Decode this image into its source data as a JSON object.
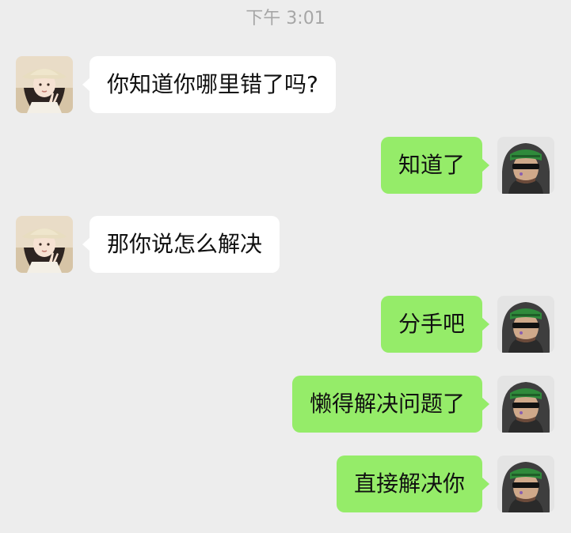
{
  "timestamp": "下午 3:01",
  "messages": [
    {
      "sender": "other",
      "text": "你知道你哪里错了吗?"
    },
    {
      "sender": "me",
      "text": "知道了"
    },
    {
      "sender": "other",
      "text": "那你说怎么解决"
    },
    {
      "sender": "me",
      "text": "分手吧"
    },
    {
      "sender": "me",
      "text": "懒得解决问题了"
    },
    {
      "sender": "me",
      "text": "直接解决你"
    }
  ],
  "colors": {
    "background": "#ededed",
    "incoming_bubble": "#ffffff",
    "outgoing_bubble": "#95ec69",
    "timestamp_text": "#a6a6a6"
  },
  "icons": {
    "other_avatar": "girl-bucket-hat-avatar-icon",
    "my_avatar": "anime-sunglasses-green-cap-avatar-icon"
  }
}
